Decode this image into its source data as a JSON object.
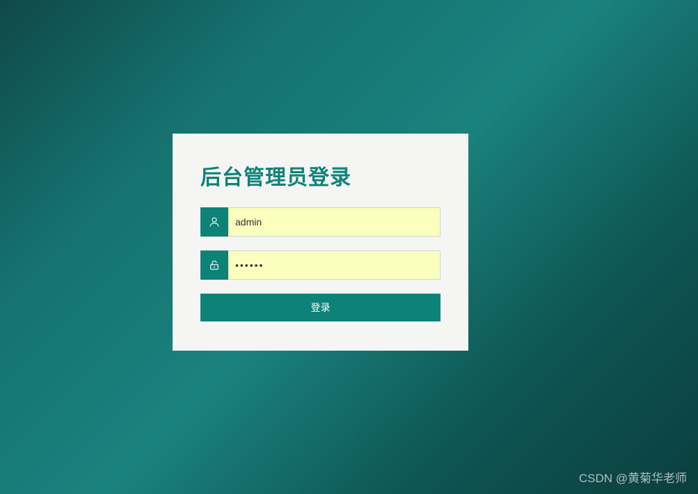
{
  "login": {
    "title": "后台管理员登录",
    "username_value": "admin",
    "username_placeholder": "",
    "password_value": "••••••",
    "password_placeholder": "",
    "submit_label": "登录"
  },
  "watermark": {
    "text": "CSDN @黄菊华老师"
  },
  "colors": {
    "accent": "#0d8378",
    "panel_bg": "#f5f5f3",
    "input_bg": "#faffbd"
  }
}
